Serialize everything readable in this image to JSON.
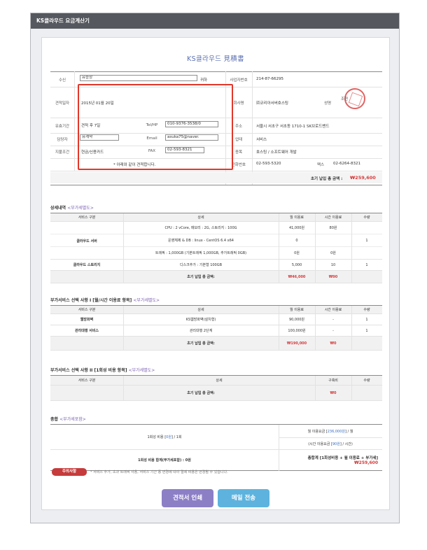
{
  "window": {
    "title": "KS클라우드 요금계산기"
  },
  "document": {
    "title": "KS클라우드 見積書"
  },
  "header_form": {
    "recipient_label": "수신",
    "recipient_value": "유승상",
    "honorific": "귀하",
    "date_label": "견적일자",
    "date_value": "2015년 01월 20일",
    "validity_label": "유효기간",
    "validity_value": "견적 후 7일",
    "tel_label": "Tel/HP",
    "tel_value": "010-9376-3538/0",
    "manager_label": "담당자",
    "manager_value": "유계약",
    "email_label": "Email",
    "email_value": "asuka75@naver.",
    "payment_label": "지불조건",
    "payment_value": "현금/신용카드",
    "fax_label": "FAX",
    "fax_value": "02-593-8321",
    "note": "* 아래와 같이 견적합니다."
  },
  "supplier": {
    "bizno_label": "사업자번호",
    "bizno_value": "214-87-66295",
    "company_label": "회사명",
    "company_value": "㈜코리아서버호스팅",
    "name_label": "성명",
    "name_value": "조현",
    "address_label": "주소",
    "address_value": "서울시 서초구 서초동 1710-1 SK브로드밴드",
    "business_label": "업태",
    "business_value": "서비스",
    "item_label": "종목",
    "item_value": "호스팅 / 소프트웨어 개발",
    "phone_label": "전화번호",
    "phone_value": "02-593-5320",
    "fax_label": "팩스",
    "fax_value": "02-6264-8321"
  },
  "initial_total": {
    "label": "초기 납입 총 금액 :",
    "value": "₩259,600"
  },
  "details": {
    "title": "상세내역",
    "sub": "<부가세별도>",
    "headers": [
      "서비스 구분",
      "상세",
      "월 이용료",
      "시간 이용료",
      "수량"
    ],
    "cloud_server_label": "클라우드 서버",
    "cloud_rows": [
      {
        "detail": "CPU : 2 vCore, 메모리 : 2G, 스토리지 : 100G",
        "monthly": "41,000원",
        "hourly": "80원"
      },
      {
        "detail": "운영체제 & DB : linux - CentOS 6.4 x64",
        "monthly": "0",
        "hourly": ""
      },
      {
        "detail": "트래픽 : 1,000GB (기본트래픽 1,000GB, 추가트래픽 0GB)",
        "monthly": "0원",
        "hourly": "0원"
      }
    ],
    "cloud_qty": "1",
    "storage_row": {
      "label": "클라우드 스토리지",
      "detail": "디스크추가 : 기본형 100GB",
      "monthly": "5,000",
      "hourly": "10",
      "qty": "1"
    },
    "total_label": "초기 납입 총 금액:",
    "total_monthly": "₩46,000",
    "total_hourly": "₩90"
  },
  "addon1": {
    "title": "부가서비스 선택 사항 I [월/시간 이용료 항목]",
    "sub": "<부가세별도>",
    "headers": [
      "서비스 구분",
      "상세",
      "월 이용료",
      "시간 이용료",
      "수량"
    ],
    "rows": [
      {
        "name": "웹방화벽",
        "detail": "KS웹방화벽(설치형)",
        "monthly": "90,000원",
        "hourly": "-",
        "qty": "1"
      },
      {
        "name": "관리대행 서비스",
        "detail": "관리대행 2단계",
        "monthly": "100,000원",
        "hourly": "-",
        "qty": "1"
      }
    ],
    "total_label": "초기 납입 총 금액:",
    "total_monthly": "₩190,000",
    "total_hourly": "₩0"
  },
  "addon2": {
    "title": "부가서비스 선택 사항 II [1회성 비용 항목]",
    "sub": "<부가세별도>",
    "headers": [
      "서비스 구분",
      "상세",
      "구축비",
      "수량"
    ],
    "total_label": "초기 납입 총 금액:",
    "total_value": "₩0"
  },
  "summary": {
    "title": "총합",
    "sub": "<부가세포함>",
    "onetime_prefix": "1회성 비용 [",
    "onetime_value": "0원",
    "onetime_suffix": "] / 1회",
    "monthly_prefix": "월 이용요금 [",
    "monthly_value": "236,000원",
    "monthly_suffix": "] / 월",
    "hourly_prefix": "(시간 이용요금 [",
    "hourly_value": "90원",
    "hourly_suffix": "] / 시간)",
    "onetime_total": "1회성 비용 합계(부가세포함) : 0원",
    "grand_label": "총합계 [1회성비용 + 월 이용료 + 부가세]",
    "grand_value": "₩259,600"
  },
  "notice": {
    "badge": "주의사항",
    "text": "* 서비스 추가, 초과 트래픽 사용, 서비스 기간 등 변경에 따라 결제 비용은 변경될 수 있습니다."
  },
  "buttons": {
    "print": "견적서 인쇄",
    "mail": "메일 전송"
  },
  "colors": {
    "titlebar": "#55585e",
    "accent_red": "#d43c3c",
    "print_btn": "#8d7fc6",
    "mail_btn": "#5db3de",
    "highlight_box": "#e2372b"
  }
}
